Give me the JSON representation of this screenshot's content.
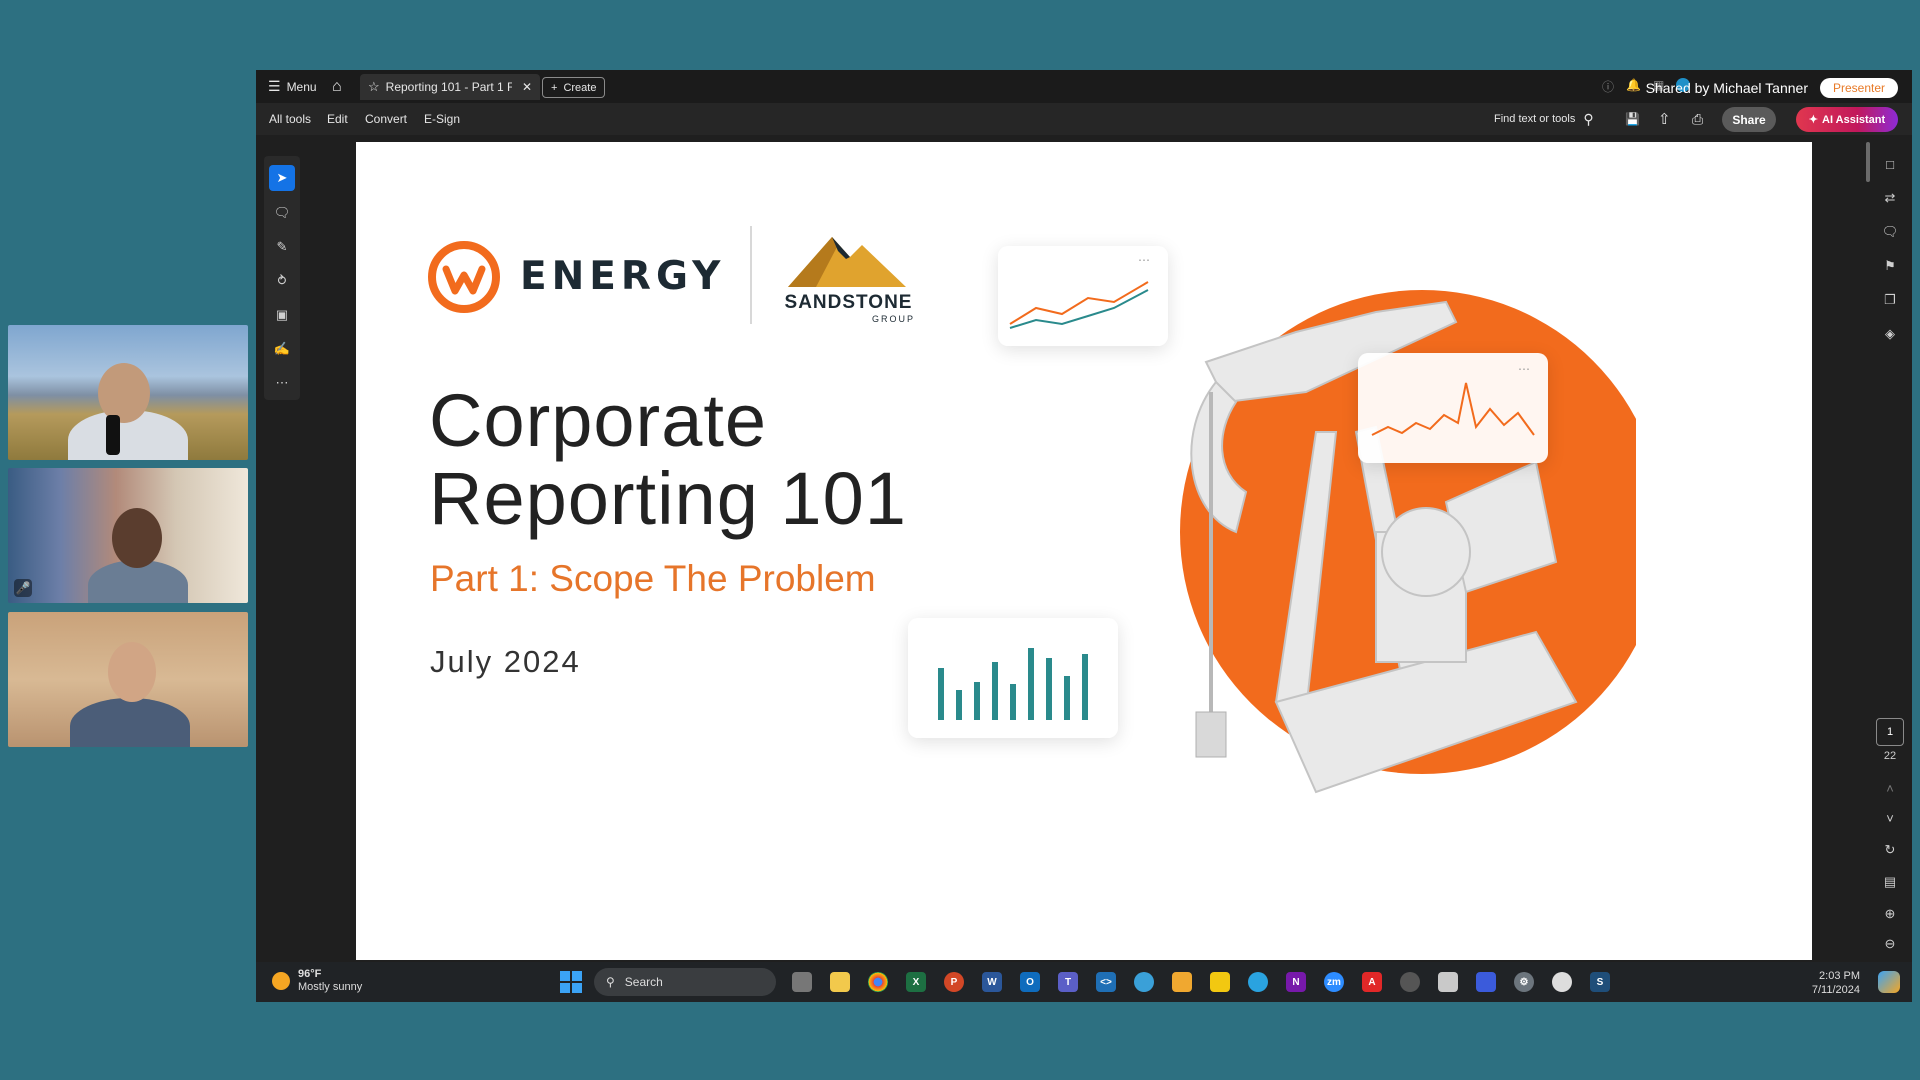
{
  "window": {
    "menu_label": "Menu",
    "tab_title": "Reporting 101 - Part 1 Fin...",
    "create_label": "Create",
    "shared_by": "Shared by Michael Tanner",
    "presenter_label": "Presenter"
  },
  "menubar": {
    "items": [
      "All tools",
      "Edit",
      "Convert",
      "E-Sign"
    ],
    "find_placeholder": "Find text or tools",
    "share_label": "Share",
    "ai_label": "AI Assistant"
  },
  "pages": {
    "current": "1",
    "total": "22"
  },
  "slide": {
    "logo_text": "ENERGY",
    "logo_partner": "SANDSTONE",
    "logo_partner_sub": "GROUP",
    "title_line1": "Corporate",
    "title_line2": "Reporting 101",
    "subtitle": "Part 1: Scope The Problem",
    "date": "July 2024",
    "accent_color": "#f26b1d"
  },
  "taskbar": {
    "weather_temp": "96°F",
    "weather_desc": "Mostly sunny",
    "search_label": "Search",
    "time": "2:03 PM",
    "date": "7/11/2024"
  }
}
